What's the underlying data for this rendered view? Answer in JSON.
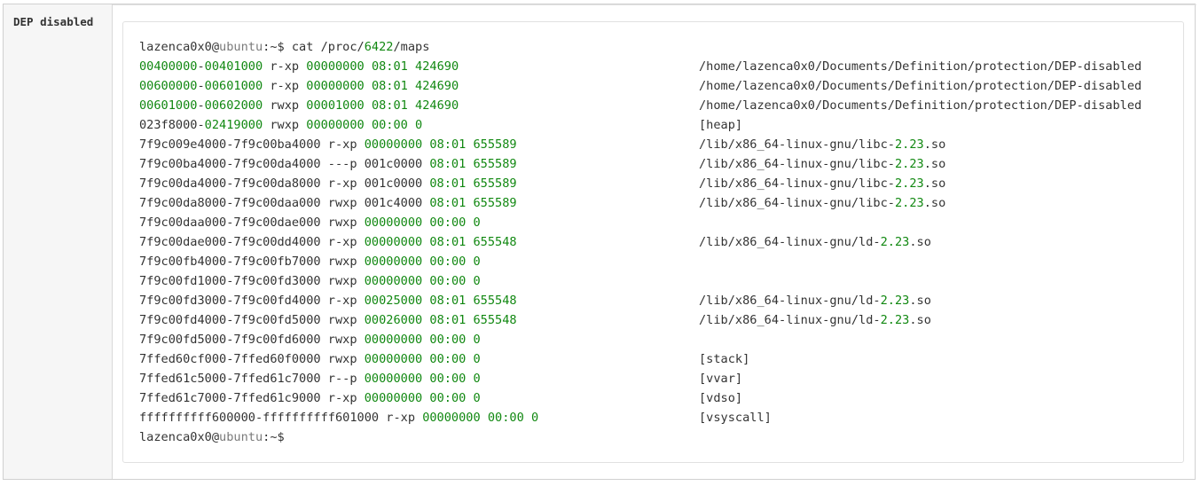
{
  "row_label": "DEP disabled",
  "colors": {
    "number": "#118811",
    "text": "#333333",
    "muted": "#7a7a7a",
    "label_bg": "#f6f6f6"
  },
  "terminal": {
    "prompt_line": [
      {
        "t": "lazenca0x0",
        "c": "plain"
      },
      {
        "t": "@",
        "c": "plain"
      },
      {
        "t": "ubuntu",
        "c": "muted"
      },
      {
        "t": ":~$ cat /proc/",
        "c": "plain"
      },
      {
        "t": "6422",
        "c": "num"
      },
      {
        "t": "/maps",
        "c": "plain"
      }
    ],
    "maps": [
      {
        "left": [
          {
            "t": "00400000",
            "c": "num"
          },
          {
            "t": "-",
            "c": "plain"
          },
          {
            "t": "00401000",
            "c": "num"
          },
          {
            "t": " r-xp ",
            "c": "plain"
          },
          {
            "t": "00000000",
            "c": "num"
          },
          {
            "t": " ",
            "c": "plain"
          },
          {
            "t": "08:01",
            "c": "num"
          },
          {
            "t": " ",
            "c": "plain"
          },
          {
            "t": "424690",
            "c": "num"
          }
        ],
        "right": [
          {
            "t": "/home/lazenca0x0/Documents/Definition/protection/DEP-disabled",
            "c": "plain"
          }
        ]
      },
      {
        "left": [
          {
            "t": "00600000",
            "c": "num"
          },
          {
            "t": "-",
            "c": "plain"
          },
          {
            "t": "00601000",
            "c": "num"
          },
          {
            "t": " r-xp ",
            "c": "plain"
          },
          {
            "t": "00000000",
            "c": "num"
          },
          {
            "t": " ",
            "c": "plain"
          },
          {
            "t": "08:01",
            "c": "num"
          },
          {
            "t": " ",
            "c": "plain"
          },
          {
            "t": "424690",
            "c": "num"
          }
        ],
        "right": [
          {
            "t": "/home/lazenca0x0/Documents/Definition/protection/DEP-disabled",
            "c": "plain"
          }
        ]
      },
      {
        "left": [
          {
            "t": "00601000",
            "c": "num"
          },
          {
            "t": "-",
            "c": "plain"
          },
          {
            "t": "00602000",
            "c": "num"
          },
          {
            "t": " rwxp ",
            "c": "plain"
          },
          {
            "t": "00001000",
            "c": "num"
          },
          {
            "t": " ",
            "c": "plain"
          },
          {
            "t": "08:01",
            "c": "num"
          },
          {
            "t": " ",
            "c": "plain"
          },
          {
            "t": "424690",
            "c": "num"
          }
        ],
        "right": [
          {
            "t": "/home/lazenca0x0/Documents/Definition/protection/DEP-disabled",
            "c": "plain"
          }
        ]
      },
      {
        "left": [
          {
            "t": "023f8000-",
            "c": "plain"
          },
          {
            "t": "02419000",
            "c": "num"
          },
          {
            "t": " rwxp ",
            "c": "plain"
          },
          {
            "t": "00000000",
            "c": "num"
          },
          {
            "t": " ",
            "c": "plain"
          },
          {
            "t": "00:00",
            "c": "num"
          },
          {
            "t": " ",
            "c": "plain"
          },
          {
            "t": "0",
            "c": "num"
          }
        ],
        "right": [
          {
            "t": "[heap]",
            "c": "plain"
          }
        ]
      },
      {
        "left": [
          {
            "t": "7f9c009e4000-7f9c00ba4000 r-xp ",
            "c": "plain"
          },
          {
            "t": "00000000",
            "c": "num"
          },
          {
            "t": " ",
            "c": "plain"
          },
          {
            "t": "08:01",
            "c": "num"
          },
          {
            "t": " ",
            "c": "plain"
          },
          {
            "t": "655589",
            "c": "num"
          }
        ],
        "right": [
          {
            "t": "/lib/x86_64-linux-gnu/libc-",
            "c": "plain"
          },
          {
            "t": "2.23",
            "c": "num"
          },
          {
            "t": ".so",
            "c": "plain"
          }
        ]
      },
      {
        "left": [
          {
            "t": "7f9c00ba4000-7f9c00da4000 ---p 001c0000 ",
            "c": "plain"
          },
          {
            "t": "08:01",
            "c": "num"
          },
          {
            "t": " ",
            "c": "plain"
          },
          {
            "t": "655589",
            "c": "num"
          }
        ],
        "right": [
          {
            "t": "/lib/x86_64-linux-gnu/libc-",
            "c": "plain"
          },
          {
            "t": "2.23",
            "c": "num"
          },
          {
            "t": ".so",
            "c": "plain"
          }
        ]
      },
      {
        "left": [
          {
            "t": "7f9c00da4000-7f9c00da8000 r-xp 001c0000 ",
            "c": "plain"
          },
          {
            "t": "08:01",
            "c": "num"
          },
          {
            "t": " ",
            "c": "plain"
          },
          {
            "t": "655589",
            "c": "num"
          }
        ],
        "right": [
          {
            "t": "/lib/x86_64-linux-gnu/libc-",
            "c": "plain"
          },
          {
            "t": "2.23",
            "c": "num"
          },
          {
            "t": ".so",
            "c": "plain"
          }
        ]
      },
      {
        "left": [
          {
            "t": "7f9c00da8000-7f9c00daa000 rwxp 001c4000 ",
            "c": "plain"
          },
          {
            "t": "08:01",
            "c": "num"
          },
          {
            "t": " ",
            "c": "plain"
          },
          {
            "t": "655589",
            "c": "num"
          }
        ],
        "right": [
          {
            "t": "/lib/x86_64-linux-gnu/libc-",
            "c": "plain"
          },
          {
            "t": "2.23",
            "c": "num"
          },
          {
            "t": ".so",
            "c": "plain"
          }
        ]
      },
      {
        "left": [
          {
            "t": "7f9c00daa000-7f9c00dae000 rwxp ",
            "c": "plain"
          },
          {
            "t": "00000000",
            "c": "num"
          },
          {
            "t": " ",
            "c": "plain"
          },
          {
            "t": "00:00",
            "c": "num"
          },
          {
            "t": " ",
            "c": "plain"
          },
          {
            "t": "0",
            "c": "num"
          }
        ],
        "right": []
      },
      {
        "left": [
          {
            "t": "7f9c00dae000-7f9c00dd4000 r-xp ",
            "c": "plain"
          },
          {
            "t": "00000000",
            "c": "num"
          },
          {
            "t": " ",
            "c": "plain"
          },
          {
            "t": "08:01",
            "c": "num"
          },
          {
            "t": " ",
            "c": "plain"
          },
          {
            "t": "655548",
            "c": "num"
          }
        ],
        "right": [
          {
            "t": "/lib/x86_64-linux-gnu/ld-",
            "c": "plain"
          },
          {
            "t": "2.23",
            "c": "num"
          },
          {
            "t": ".so",
            "c": "plain"
          }
        ]
      },
      {
        "left": [
          {
            "t": "7f9c00fb4000-7f9c00fb7000 rwxp ",
            "c": "plain"
          },
          {
            "t": "00000000",
            "c": "num"
          },
          {
            "t": " ",
            "c": "plain"
          },
          {
            "t": "00:00",
            "c": "num"
          },
          {
            "t": " ",
            "c": "plain"
          },
          {
            "t": "0",
            "c": "num"
          }
        ],
        "right": []
      },
      {
        "left": [
          {
            "t": "7f9c00fd1000-7f9c00fd3000 rwxp ",
            "c": "plain"
          },
          {
            "t": "00000000",
            "c": "num"
          },
          {
            "t": " ",
            "c": "plain"
          },
          {
            "t": "00:00",
            "c": "num"
          },
          {
            "t": " ",
            "c": "plain"
          },
          {
            "t": "0",
            "c": "num"
          }
        ],
        "right": []
      },
      {
        "left": [
          {
            "t": "7f9c00fd3000-7f9c00fd4000 r-xp ",
            "c": "plain"
          },
          {
            "t": "00025000",
            "c": "num"
          },
          {
            "t": " ",
            "c": "plain"
          },
          {
            "t": "08:01",
            "c": "num"
          },
          {
            "t": " ",
            "c": "plain"
          },
          {
            "t": "655548",
            "c": "num"
          }
        ],
        "right": [
          {
            "t": "/lib/x86_64-linux-gnu/ld-",
            "c": "plain"
          },
          {
            "t": "2.23",
            "c": "num"
          },
          {
            "t": ".so",
            "c": "plain"
          }
        ]
      },
      {
        "left": [
          {
            "t": "7f9c00fd4000-7f9c00fd5000 rwxp ",
            "c": "plain"
          },
          {
            "t": "00026000",
            "c": "num"
          },
          {
            "t": " ",
            "c": "plain"
          },
          {
            "t": "08:01",
            "c": "num"
          },
          {
            "t": " ",
            "c": "plain"
          },
          {
            "t": "655548",
            "c": "num"
          }
        ],
        "right": [
          {
            "t": "/lib/x86_64-linux-gnu/ld-",
            "c": "plain"
          },
          {
            "t": "2.23",
            "c": "num"
          },
          {
            "t": ".so",
            "c": "plain"
          }
        ]
      },
      {
        "left": [
          {
            "t": "7f9c00fd5000-7f9c00fd6000 rwxp ",
            "c": "plain"
          },
          {
            "t": "00000000",
            "c": "num"
          },
          {
            "t": " ",
            "c": "plain"
          },
          {
            "t": "00:00",
            "c": "num"
          },
          {
            "t": " ",
            "c": "plain"
          },
          {
            "t": "0",
            "c": "num"
          }
        ],
        "right": []
      },
      {
        "left": [
          {
            "t": "7ffed60cf000-7ffed60f0000 rwxp ",
            "c": "plain"
          },
          {
            "t": "00000000",
            "c": "num"
          },
          {
            "t": " ",
            "c": "plain"
          },
          {
            "t": "00:00",
            "c": "num"
          },
          {
            "t": " ",
            "c": "plain"
          },
          {
            "t": "0",
            "c": "num"
          }
        ],
        "right": [
          {
            "t": "[stack]",
            "c": "plain"
          }
        ]
      },
      {
        "left": [
          {
            "t": "7ffed61c5000-7ffed61c7000 r--p ",
            "c": "plain"
          },
          {
            "t": "00000000",
            "c": "num"
          },
          {
            "t": " ",
            "c": "plain"
          },
          {
            "t": "00:00",
            "c": "num"
          },
          {
            "t": " ",
            "c": "plain"
          },
          {
            "t": "0",
            "c": "num"
          }
        ],
        "right": [
          {
            "t": "[vvar]",
            "c": "plain"
          }
        ]
      },
      {
        "left": [
          {
            "t": "7ffed61c7000-7ffed61c9000 r-xp ",
            "c": "plain"
          },
          {
            "t": "00000000",
            "c": "num"
          },
          {
            "t": " ",
            "c": "plain"
          },
          {
            "t": "00:00",
            "c": "num"
          },
          {
            "t": " ",
            "c": "plain"
          },
          {
            "t": "0",
            "c": "num"
          }
        ],
        "right": [
          {
            "t": "[vdso]",
            "c": "plain"
          }
        ]
      },
      {
        "left": [
          {
            "t": "ffffffffff600000-ffffffffff601000 r-xp ",
            "c": "plain"
          },
          {
            "t": "00000000",
            "c": "num"
          },
          {
            "t": " ",
            "c": "plain"
          },
          {
            "t": "00:00",
            "c": "num"
          },
          {
            "t": " ",
            "c": "plain"
          },
          {
            "t": "0",
            "c": "num"
          }
        ],
        "right": [
          {
            "t": "[vsyscall]",
            "c": "plain"
          }
        ]
      }
    ],
    "end_prompt": [
      {
        "t": "lazenca0x0",
        "c": "plain"
      },
      {
        "t": "@",
        "c": "plain"
      },
      {
        "t": "ubuntu",
        "c": "muted"
      },
      {
        "t": ":~$",
        "c": "plain"
      }
    ]
  }
}
